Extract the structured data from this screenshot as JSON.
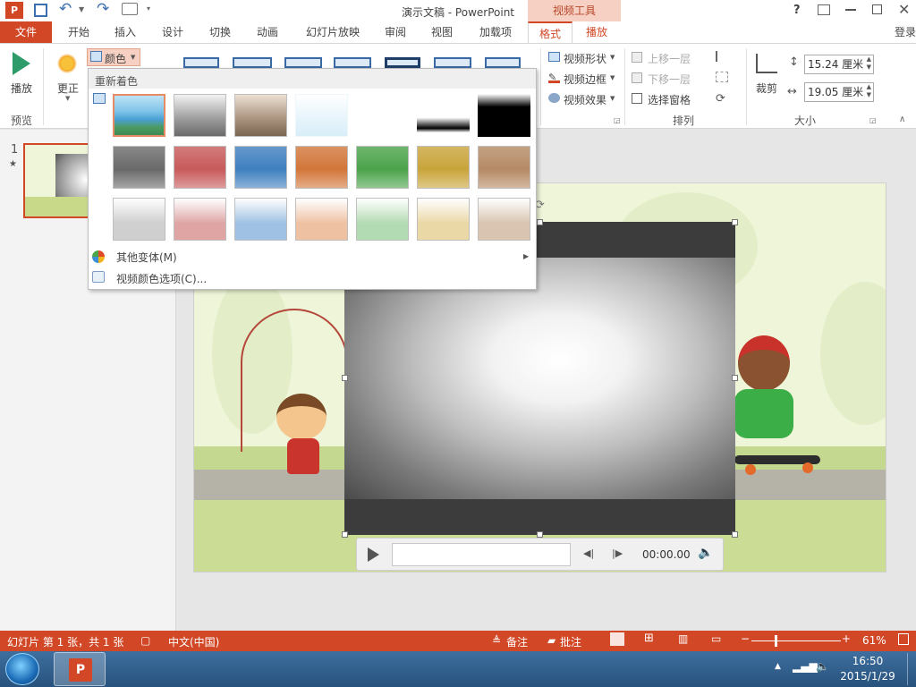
{
  "window": {
    "title": "演示文稿 - PowerPoint",
    "context_header": "视频工具",
    "help": "?",
    "sign_in": "登录"
  },
  "tabs": [
    {
      "label": "文件"
    },
    {
      "label": "开始"
    },
    {
      "label": "插入"
    },
    {
      "label": "设计"
    },
    {
      "label": "切换"
    },
    {
      "label": "动画"
    },
    {
      "label": "幻灯片放映"
    },
    {
      "label": "审阅"
    },
    {
      "label": "视图"
    },
    {
      "label": "加载项"
    },
    {
      "label": "格式"
    },
    {
      "label": "播放"
    }
  ],
  "ribbon": {
    "play": "播放",
    "correct": "更正",
    "color": "颜色",
    "preview_group": "预览",
    "video_shape": "视频形状",
    "video_border": "视频边框",
    "video_effects": "视频效果",
    "bring_forward": "上移一层",
    "send_backward": "下移一层",
    "selection_pane": "选择窗格",
    "arrange_group": "排列",
    "crop": "裁剪",
    "height": "15.24 厘米",
    "width": "19.05 厘米",
    "size_group": "大小"
  },
  "dropdown": {
    "header": "重新着色",
    "more_variations": "其他变体(M)",
    "color_options": "视频颜色选项(C)...",
    "swatches_row2": [
      "#6a6a6a",
      "#c85a5a",
      "#3f7fbf",
      "#d2763a",
      "#4aa34a",
      "#c9a43a",
      "#b58a65"
    ],
    "swatches_row3": [
      "#cfcfcf",
      "#dfa5a5",
      "#9fc1e3",
      "#efc1a3",
      "#b3dbb3",
      "#ead8a6",
      "#d8c4b0"
    ]
  },
  "thumbnails": {
    "number": "1",
    "star": "★"
  },
  "player": {
    "time": "00:00.00"
  },
  "status": {
    "slide_info": "幻灯片 第 1 张，共 1 张",
    "language": "中文(中国)",
    "notes": "备注",
    "comments": "批注",
    "zoom": "61%"
  },
  "taskbar": {
    "time": "16:50",
    "date": "2015/1/29"
  },
  "colors": {
    "accent": "#d24726",
    "accent_light": "#f6d0c2"
  }
}
